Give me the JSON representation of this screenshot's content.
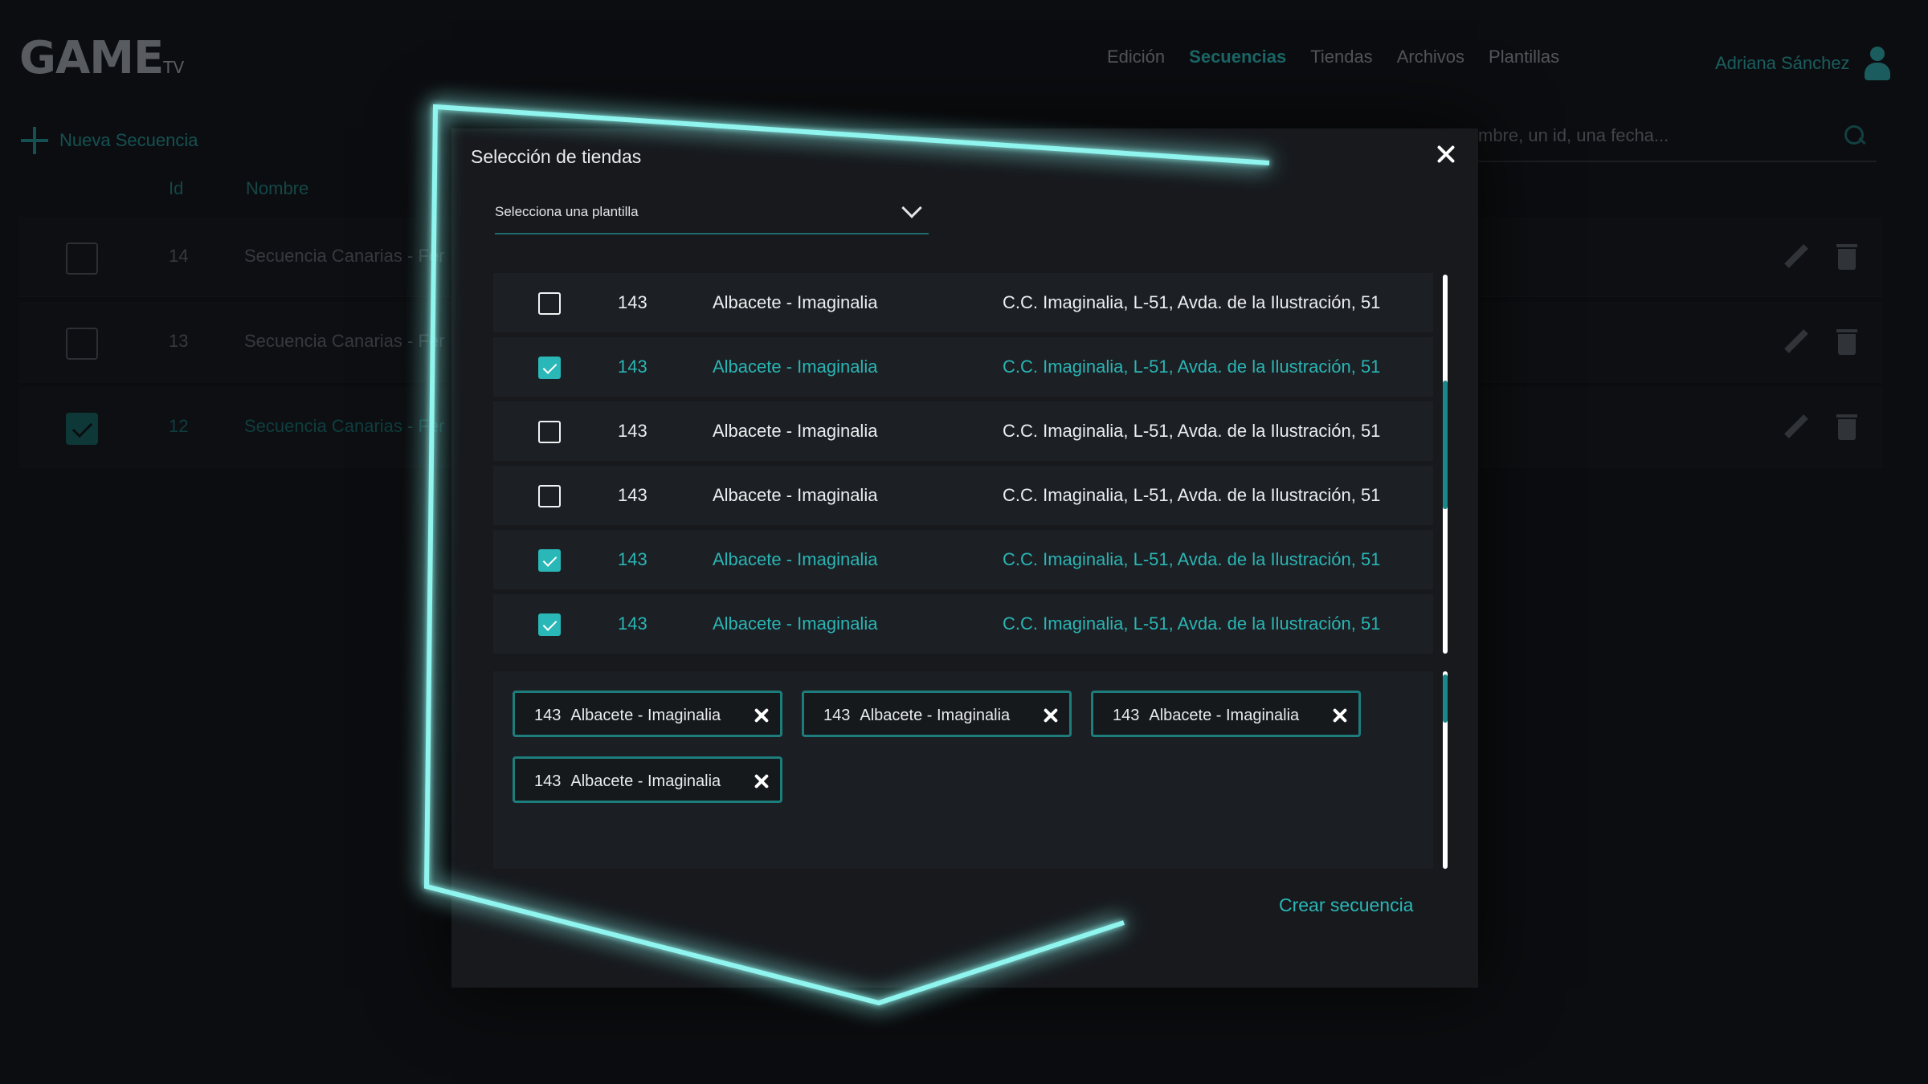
{
  "brand": {
    "logo": "GAME",
    "logo_suffix": "TV"
  },
  "nav": [
    {
      "label": "Edición",
      "active": false
    },
    {
      "label": "Secuencias",
      "active": true
    },
    {
      "label": "Tiendas",
      "active": false
    },
    {
      "label": "Archivos",
      "active": false
    },
    {
      "label": "Plantillas",
      "active": false
    }
  ],
  "user": {
    "name": "Adriana Sánchez"
  },
  "page": {
    "new_sequence_label": "Nueva Secuencia",
    "search_placeholder": "mbre, un id, una fecha...",
    "columns": {
      "id": "Id",
      "name": "Nombre"
    },
    "rows": [
      {
        "id": "14",
        "name": "Secuencia Canarias - Fer",
        "checked": false
      },
      {
        "id": "13",
        "name": "Secuencia Canarias - Fer",
        "checked": false
      },
      {
        "id": "12",
        "name": "Secuencia Canarias - Fer",
        "checked": true
      }
    ]
  },
  "modal": {
    "title": "Selección de tiendas",
    "template_select": {
      "value": "Selecciona una plantilla"
    },
    "stores": [
      {
        "id": "143",
        "name": "Albacete - Imaginalia",
        "address": "C.C. Imaginalia, L-51, Avda. de la Ilustración, 51",
        "checked": false
      },
      {
        "id": "143",
        "name": "Albacete - Imaginalia",
        "address": "C.C. Imaginalia, L-51, Avda. de la Ilustración, 51",
        "checked": true
      },
      {
        "id": "143",
        "name": "Albacete - Imaginalia",
        "address": "C.C. Imaginalia, L-51, Avda. de la Ilustración, 51",
        "checked": false
      },
      {
        "id": "143",
        "name": "Albacete - Imaginalia",
        "address": "C.C. Imaginalia, L-51, Avda. de la Ilustración, 51",
        "checked": false
      },
      {
        "id": "143",
        "name": "Albacete - Imaginalia",
        "address": "C.C. Imaginalia, L-51, Avda. de la Ilustración, 51",
        "checked": true
      },
      {
        "id": "143",
        "name": "Albacete - Imaginalia",
        "address": "C.C. Imaginalia, L-51, Avda. de la Ilustración, 51",
        "checked": true
      }
    ],
    "selected_chips": [
      {
        "id": "143",
        "name": "Albacete - Imaginalia"
      },
      {
        "id": "143",
        "name": "Albacete - Imaginalia"
      },
      {
        "id": "143",
        "name": "Albacete - Imaginalia"
      },
      {
        "id": "143",
        "name": "Albacete - Imaginalia"
      }
    ],
    "create_button": "Crear secuencia"
  },
  "colors": {
    "accent": "#2ab7b7",
    "background": "#0f1114",
    "modal_background": "#17191d",
    "neon_outline": "#8ff5ee"
  },
  "icons": [
    "user-icon",
    "plus-icon",
    "search-icon",
    "edit-icon",
    "trash-icon",
    "close-icon",
    "chevron-down-icon",
    "checkbox-icon",
    "remove-chip-icon"
  ]
}
